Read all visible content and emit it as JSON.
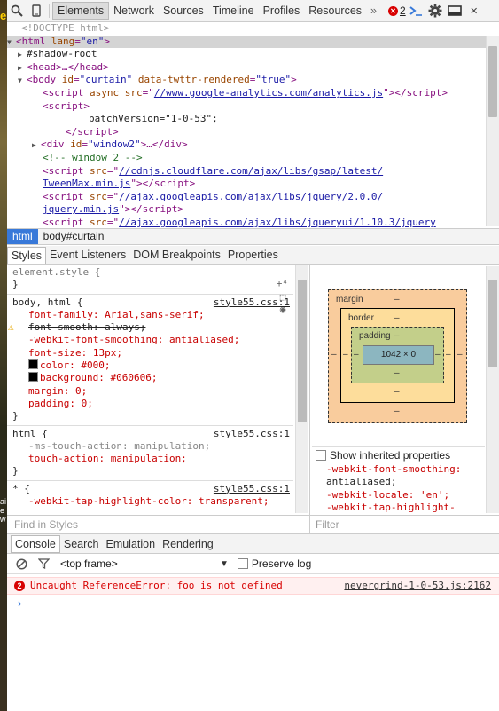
{
  "toolbar": {
    "tabs": [
      "Elements",
      "Network",
      "Sources",
      "Timeline",
      "Profiles",
      "Resources"
    ],
    "active_tab": "Elements",
    "overflow": "»",
    "error_count": "2"
  },
  "dom": {
    "doctype": "<!DOCTYPE html>",
    "shadow_root": "#shadow-root",
    "patch_version": "patchVersion=\"1-0-53\";",
    "window_comment": "<!-- window 2 -->",
    "analytics_src": "//www.google-analytics.com/analytics.js",
    "tweenmax_src_1": "//cdnjs.cloudflare.com/ajax/libs/gsap/latest/",
    "tweenmax_src_2": "TweenMax.min.js",
    "jquery_src_1": "//ajax.googleapis.com/ajax/libs/jquery/2.0.0/",
    "jquery_src_2": "jquery.min.js",
    "jqueryui_src": "//ajax.googleapis.com/ajax/libs/jqueryui/1.10.3/jquery"
  },
  "breadcrumbs": [
    "html",
    "body#curtain"
  ],
  "subtabs": [
    "Styles",
    "Event Listeners",
    "DOM Breakpoints",
    "Properties"
  ],
  "styles": {
    "element_style": "element.style {",
    "rule1": {
      "selector": "body, html {",
      "source": "style55.css:1",
      "lines": [
        "font-family: Arial,sans-serif;",
        "font-smooth: always;",
        "-webkit-font-smoothing: antialiased;",
        "font-size: 13px;",
        "color: #000;",
        "background: #060606;",
        "margin: 0;",
        "padding: 0;"
      ]
    },
    "rule2": {
      "selector": "html {",
      "source": "style55.css:1",
      "lines": [
        "-ms-touch-action: manipulation;",
        "touch-action: manipulation;"
      ]
    },
    "rule3": {
      "selector": "* {",
      "source": "style55.css:1",
      "lines": [
        "-webkit-tap-highlight-color: transparent;"
      ]
    },
    "close": "}"
  },
  "boxmodel": {
    "margin_label": "margin",
    "border_label": "border",
    "padding_label": "padding",
    "dash": "–",
    "content_size": "1042 × 0"
  },
  "inherited": {
    "checkbox_label": "Show inherited properties",
    "lines": [
      "-webkit-font-smoothing:",
      "antialiased;",
      "-webkit-locale: 'en';",
      "-webkit-tap-highlight-"
    ]
  },
  "filters": {
    "styles_placeholder": "Find in Styles",
    "filter_placeholder": "Filter"
  },
  "console": {
    "tabs": [
      "Console",
      "Search",
      "Emulation",
      "Rendering"
    ],
    "frame": "<top frame>",
    "preserve_log": "Preserve log",
    "error_count": "2",
    "error_message": "Uncaught ReferenceError: foo is not defined",
    "error_source": "nevergrind-1-0-53.js:2162",
    "prompt": "›"
  },
  "colors": {
    "selection_blue": "#3879d9",
    "error_red": "#d80000",
    "margin_box": "#f9cc9d",
    "border_box": "#fddd9b",
    "padding_box": "#c3cf8a",
    "content_box": "#8cb6c0"
  }
}
